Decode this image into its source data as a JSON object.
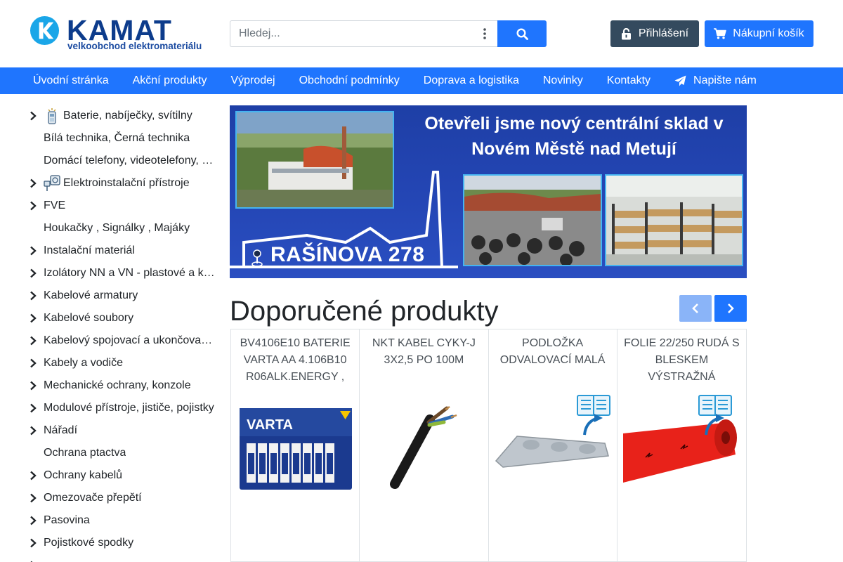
{
  "brand": {
    "name": "KAMAT",
    "tagline": "velkoobchod elektromateriálu",
    "primary_color": "#1f75fe",
    "dark_color": "#344a5e",
    "logo_color": "#0d3c8c"
  },
  "search": {
    "placeholder": "Hledej...",
    "value": ""
  },
  "header": {
    "login_label": "Přihlášení",
    "cart_label": "Nákupní košík"
  },
  "nav": {
    "items": [
      {
        "label": "Úvodní stránka"
      },
      {
        "label": "Akční produkty"
      },
      {
        "label": "Výprodej"
      },
      {
        "label": "Obchodní podmínky"
      },
      {
        "label": "Doprava a logistika"
      },
      {
        "label": "Novinky"
      },
      {
        "label": "Kontakty"
      },
      {
        "label": "Napište nám",
        "icon": "paper-plane-icon"
      }
    ]
  },
  "sidebar": {
    "categories": [
      {
        "label": "Baterie, nabíječky, svítilny",
        "expandable": true,
        "icon": "battery-icon"
      },
      {
        "label": "Bílá technika, Černá technika",
        "expandable": false
      },
      {
        "label": "Domácí telefony, videotelefony, …",
        "expandable": false
      },
      {
        "label": "Elektroinstalační přístroje",
        "expandable": true,
        "icon": "socket-plug-icon"
      },
      {
        "label": "FVE",
        "expandable": true
      },
      {
        "label": "Houkačky , Signálky , Majáky",
        "expandable": false
      },
      {
        "label": "Instalační materiál",
        "expandable": true
      },
      {
        "label": "Izolátory NN a VN - plastové a k…",
        "expandable": true
      },
      {
        "label": "Kabelové armatury",
        "expandable": true
      },
      {
        "label": "Kabelové soubory",
        "expandable": true
      },
      {
        "label": "Kabelový spojovací a ukončova…",
        "expandable": true
      },
      {
        "label": "Kabely a vodiče",
        "expandable": true
      },
      {
        "label": "Mechanické ochrany, konzole",
        "expandable": true
      },
      {
        "label": "Modulové přístroje, jističe, pojistky",
        "expandable": true
      },
      {
        "label": "Nářadí",
        "expandable": true
      },
      {
        "label": "Ochrana ptactva",
        "expandable": false
      },
      {
        "label": "Ochrany kabelů",
        "expandable": true
      },
      {
        "label": "Omezovače přepětí",
        "expandable": true
      },
      {
        "label": "Pasovina",
        "expandable": true
      },
      {
        "label": "Pojistkové spodky",
        "expandable": true
      },
      {
        "label": "",
        "expandable": true
      }
    ]
  },
  "banner": {
    "line1": "Otevřeli jsme nový centrální sklad v",
    "line2": "Novém Městě nad Metují",
    "address": "RAŠÍNOVA 278"
  },
  "recommended": {
    "title": "Doporučené produkty",
    "products": [
      {
        "name": "BV4106E10 BATERIE VARTA AA 4.106B10 R06ALK.ENERGY ,",
        "image": "varta-battery-pack"
      },
      {
        "name": "NKT KABEL CYKY-J 3X2,5 PO 100M",
        "image": "black-cable"
      },
      {
        "name": "PODLOŽKA ODVALOVACÍ MALÁ",
        "image": "roller-pad"
      },
      {
        "name": "FOLIE 22/250 RUDÁ S BLESKEM VÝSTRAŽNÁ",
        "image": "red-warning-foil"
      }
    ]
  }
}
